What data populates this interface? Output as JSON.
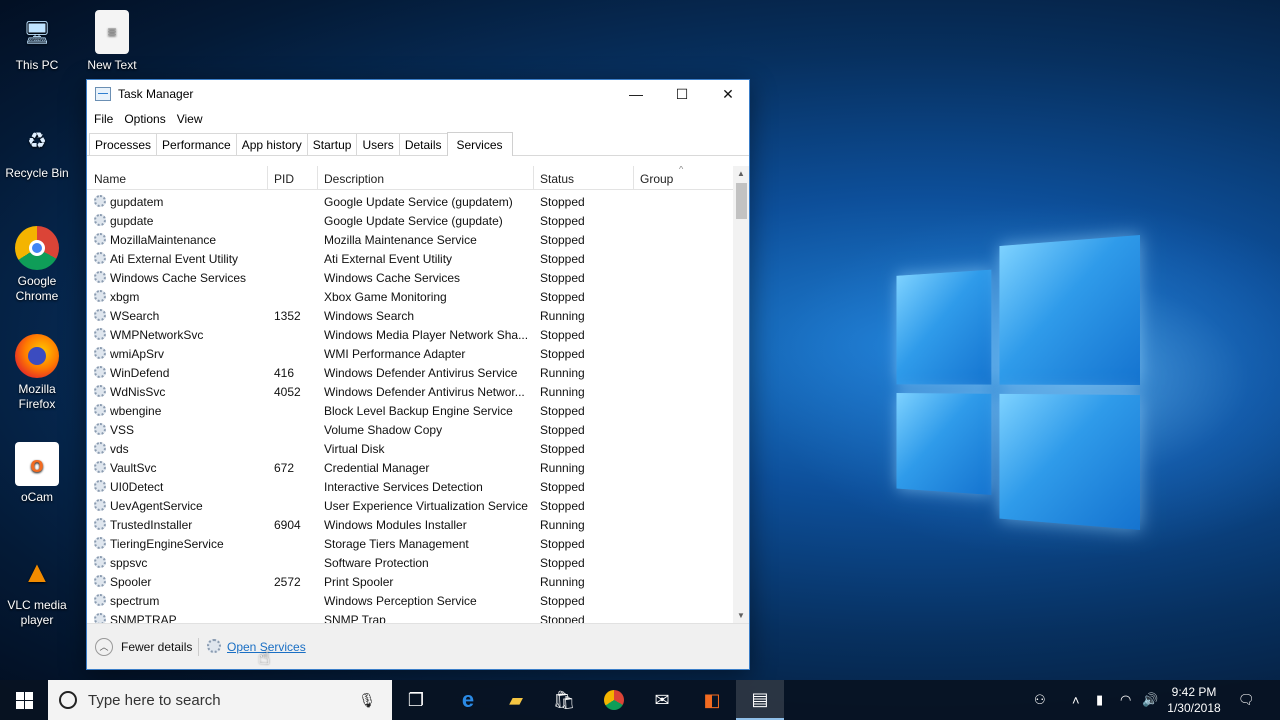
{
  "desktop": {
    "icons": [
      {
        "label": "This PC",
        "icon": "this-pc-icon"
      },
      {
        "label": "New Text",
        "icon": "text-document-icon"
      },
      {
        "label": "Recycle Bin",
        "icon": "recycle-bin-icon"
      },
      {
        "label": "Google Chrome",
        "icon": "chrome-icon"
      },
      {
        "label": "Mozilla Firefox",
        "icon": "firefox-icon"
      },
      {
        "label": "oCam",
        "icon": "ocam-icon"
      },
      {
        "label": "VLC media player",
        "icon": "vlc-icon"
      }
    ]
  },
  "window": {
    "title": "Task Manager",
    "minimize": "—",
    "maximize": "☐",
    "close": "✕"
  },
  "menu": [
    "File",
    "Options",
    "View"
  ],
  "tabs": [
    "Processes",
    "Performance",
    "App history",
    "Startup",
    "Users",
    "Details",
    "Services"
  ],
  "active_tab": "Services",
  "columns": {
    "name": "Name",
    "pid": "PID",
    "description": "Description",
    "status": "Status",
    "group": "Group"
  },
  "services": [
    {
      "name": "gupdatem",
      "pid": "",
      "description": "Google Update Service (gupdatem)",
      "status": "Stopped"
    },
    {
      "name": "gupdate",
      "pid": "",
      "description": "Google Update Service (gupdate)",
      "status": "Stopped"
    },
    {
      "name": "MozillaMaintenance",
      "pid": "",
      "description": "Mozilla Maintenance Service",
      "status": "Stopped"
    },
    {
      "name": "Ati External Event Utility",
      "pid": "",
      "description": "Ati External Event Utility",
      "status": "Stopped"
    },
    {
      "name": "Windows Cache Services",
      "pid": "",
      "description": "Windows Cache Services",
      "status": "Stopped"
    },
    {
      "name": "xbgm",
      "pid": "",
      "description": "Xbox Game Monitoring",
      "status": "Stopped"
    },
    {
      "name": "WSearch",
      "pid": "1352",
      "description": "Windows Search",
      "status": "Running"
    },
    {
      "name": "WMPNetworkSvc",
      "pid": "",
      "description": "Windows Media Player Network Sha...",
      "status": "Stopped"
    },
    {
      "name": "wmiApSrv",
      "pid": "",
      "description": "WMI Performance Adapter",
      "status": "Stopped"
    },
    {
      "name": "WinDefend",
      "pid": "416",
      "description": "Windows Defender Antivirus Service",
      "status": "Running"
    },
    {
      "name": "WdNisSvc",
      "pid": "4052",
      "description": "Windows Defender Antivirus Networ...",
      "status": "Running"
    },
    {
      "name": "wbengine",
      "pid": "",
      "description": "Block Level Backup Engine Service",
      "status": "Stopped"
    },
    {
      "name": "VSS",
      "pid": "",
      "description": "Volume Shadow Copy",
      "status": "Stopped"
    },
    {
      "name": "vds",
      "pid": "",
      "description": "Virtual Disk",
      "status": "Stopped"
    },
    {
      "name": "VaultSvc",
      "pid": "672",
      "description": "Credential Manager",
      "status": "Running"
    },
    {
      "name": "UI0Detect",
      "pid": "",
      "description": "Interactive Services Detection",
      "status": "Stopped"
    },
    {
      "name": "UevAgentService",
      "pid": "",
      "description": "User Experience Virtualization Service",
      "status": "Stopped"
    },
    {
      "name": "TrustedInstaller",
      "pid": "6904",
      "description": "Windows Modules Installer",
      "status": "Running"
    },
    {
      "name": "TieringEngineService",
      "pid": "",
      "description": "Storage Tiers Management",
      "status": "Stopped"
    },
    {
      "name": "sppsvc",
      "pid": "",
      "description": "Software Protection",
      "status": "Stopped"
    },
    {
      "name": "Spooler",
      "pid": "2572",
      "description": "Print Spooler",
      "status": "Running"
    },
    {
      "name": "spectrum",
      "pid": "",
      "description": "Windows Perception Service",
      "status": "Stopped"
    },
    {
      "name": "SNMPTRAP",
      "pid": "",
      "description": "SNMP Trap",
      "status": "Stopped"
    }
  ],
  "footer": {
    "fewer_details": "Fewer details",
    "open_services": "Open Services"
  },
  "taskbar": {
    "search_placeholder": "Type here to search",
    "time": "9:42 PM",
    "date": "1/30/2018"
  }
}
